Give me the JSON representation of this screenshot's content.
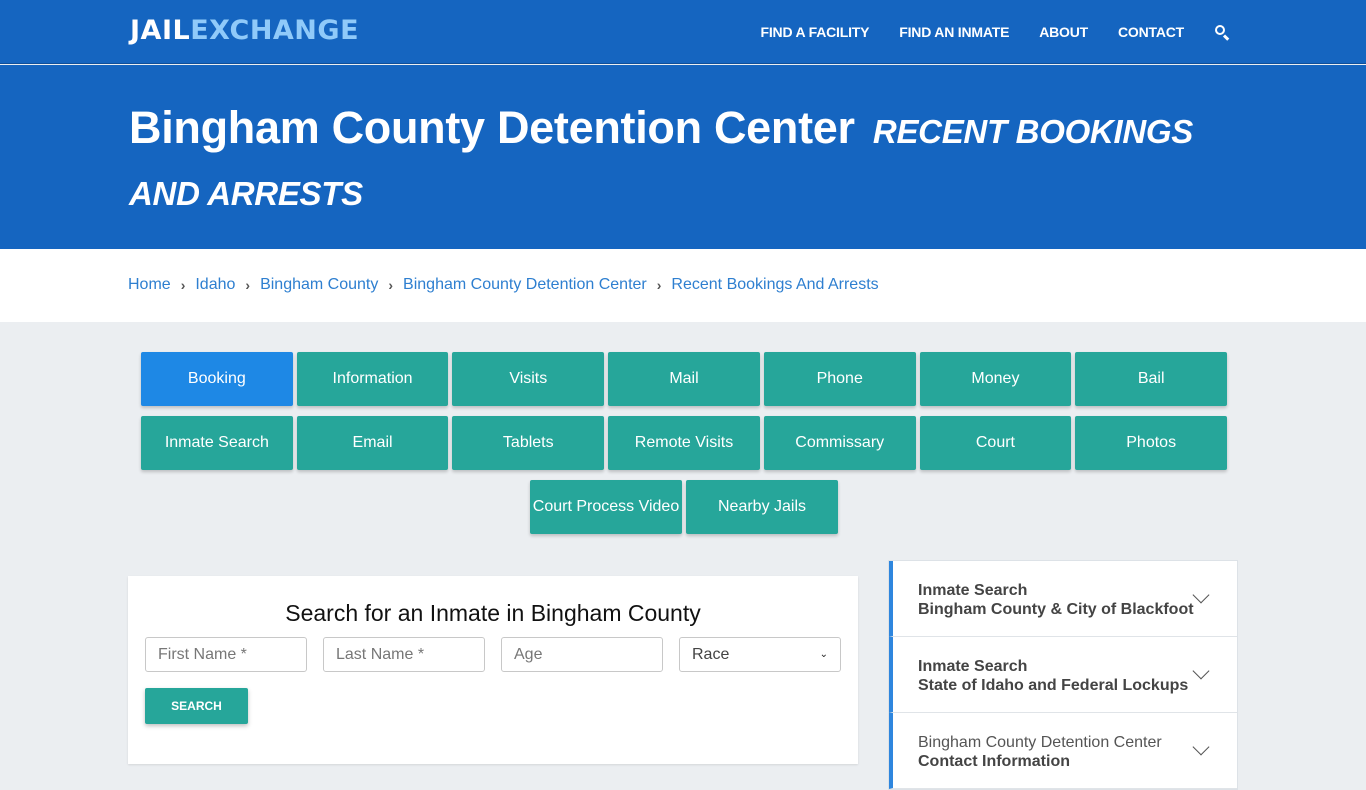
{
  "brand": {
    "part1": "JAIL",
    "part2": "EXCHANGE"
  },
  "nav": {
    "links": [
      "FIND A FACILITY",
      "FIND AN INMATE",
      "ABOUT",
      "CONTACT"
    ],
    "search_icon": "search-icon"
  },
  "hero": {
    "title": "Bingham County Detention Center",
    "subtitle": "Recent Bookings And Arrests"
  },
  "breadcrumb": [
    "Home",
    "Idaho",
    "Bingham County",
    "Bingham County Detention Center",
    "Recent Bookings And Arrests"
  ],
  "tabs": {
    "row1": [
      "Booking",
      "Information",
      "Visits",
      "Mail",
      "Phone",
      "Money",
      "Bail"
    ],
    "row2": [
      "Inmate Search",
      "Email",
      "Tablets",
      "Remote Visits",
      "Commissary",
      "Court",
      "Photos"
    ],
    "row3": [
      "Court Process Video",
      "Nearby Jails"
    ],
    "active": "Booking"
  },
  "search_form": {
    "title": "Search for an Inmate in Bingham County",
    "first_name_placeholder": "First Name *",
    "last_name_placeholder": "Last Name *",
    "age_placeholder": "Age",
    "race_selected": "Race",
    "button": "SEARCH"
  },
  "accordion": [
    {
      "line1": "Inmate Search",
      "line2": "Bingham County & City of Blackfoot"
    },
    {
      "line1": "Inmate Search",
      "line2": "State of Idaho and Federal Lockups"
    },
    {
      "line1": "Bingham County Detention Center",
      "line2": "Contact Information"
    }
  ],
  "colors": {
    "brand_blue": "#1565c0",
    "teal": "#26a69a",
    "active_blue": "#1e88e5",
    "link_blue": "#2e7fd0"
  }
}
